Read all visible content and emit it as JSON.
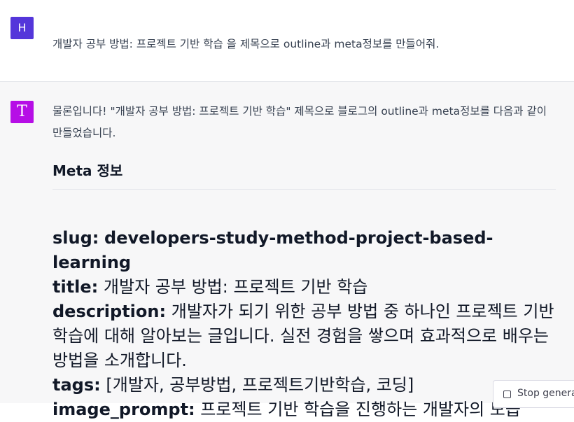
{
  "user_message": {
    "avatar_initial": "H",
    "avatar_color": "#5436da",
    "text": "개발자 공부 방법: 프로젝트 기반 학습 을 제목으로  outline과 meta정보를 만들어줘."
  },
  "assistant_message": {
    "avatar_icon": "assistant-logo-icon",
    "avatar_glyph": "T",
    "avatar_color": "#b60ee6",
    "intro": "물론입니다! \"개발자 공부 방법: 프로젝트 기반 학습\" 제목으로 블로그의 outline과 meta정보를 다음과 같이 만들었습니다.",
    "meta_heading": "Meta 정보",
    "meta_items": [
      {
        "key": "slug:",
        "value": "developers-study-method-project-based-learning",
        "value_bold": true
      },
      {
        "key": "title:",
        "value": "개발자 공부 방법: 프로젝트 기반 학습",
        "value_bold": false
      },
      {
        "key": "description:",
        "value": "개발자가 되기 위한 공부 방법 중 하나인 프로젝트 기반 학습에 대해 알아보는 글입니다. 실전 경험을 쌓으며 효과적으로 배우는 방법을 소개합니다.",
        "value_bold": false
      },
      {
        "key": "tags:",
        "value": "[개발자, 공부방법, 프로젝트기반학습, 코딩]",
        "value_bold": false
      },
      {
        "key": "image_prompt:",
        "value": "프로젝트 기반 학습을 진행하는 개발자의 모습",
        "value_bold": false
      }
    ]
  },
  "stop_button": {
    "label": "Stop generating",
    "icon": "stop-square-icon"
  }
}
